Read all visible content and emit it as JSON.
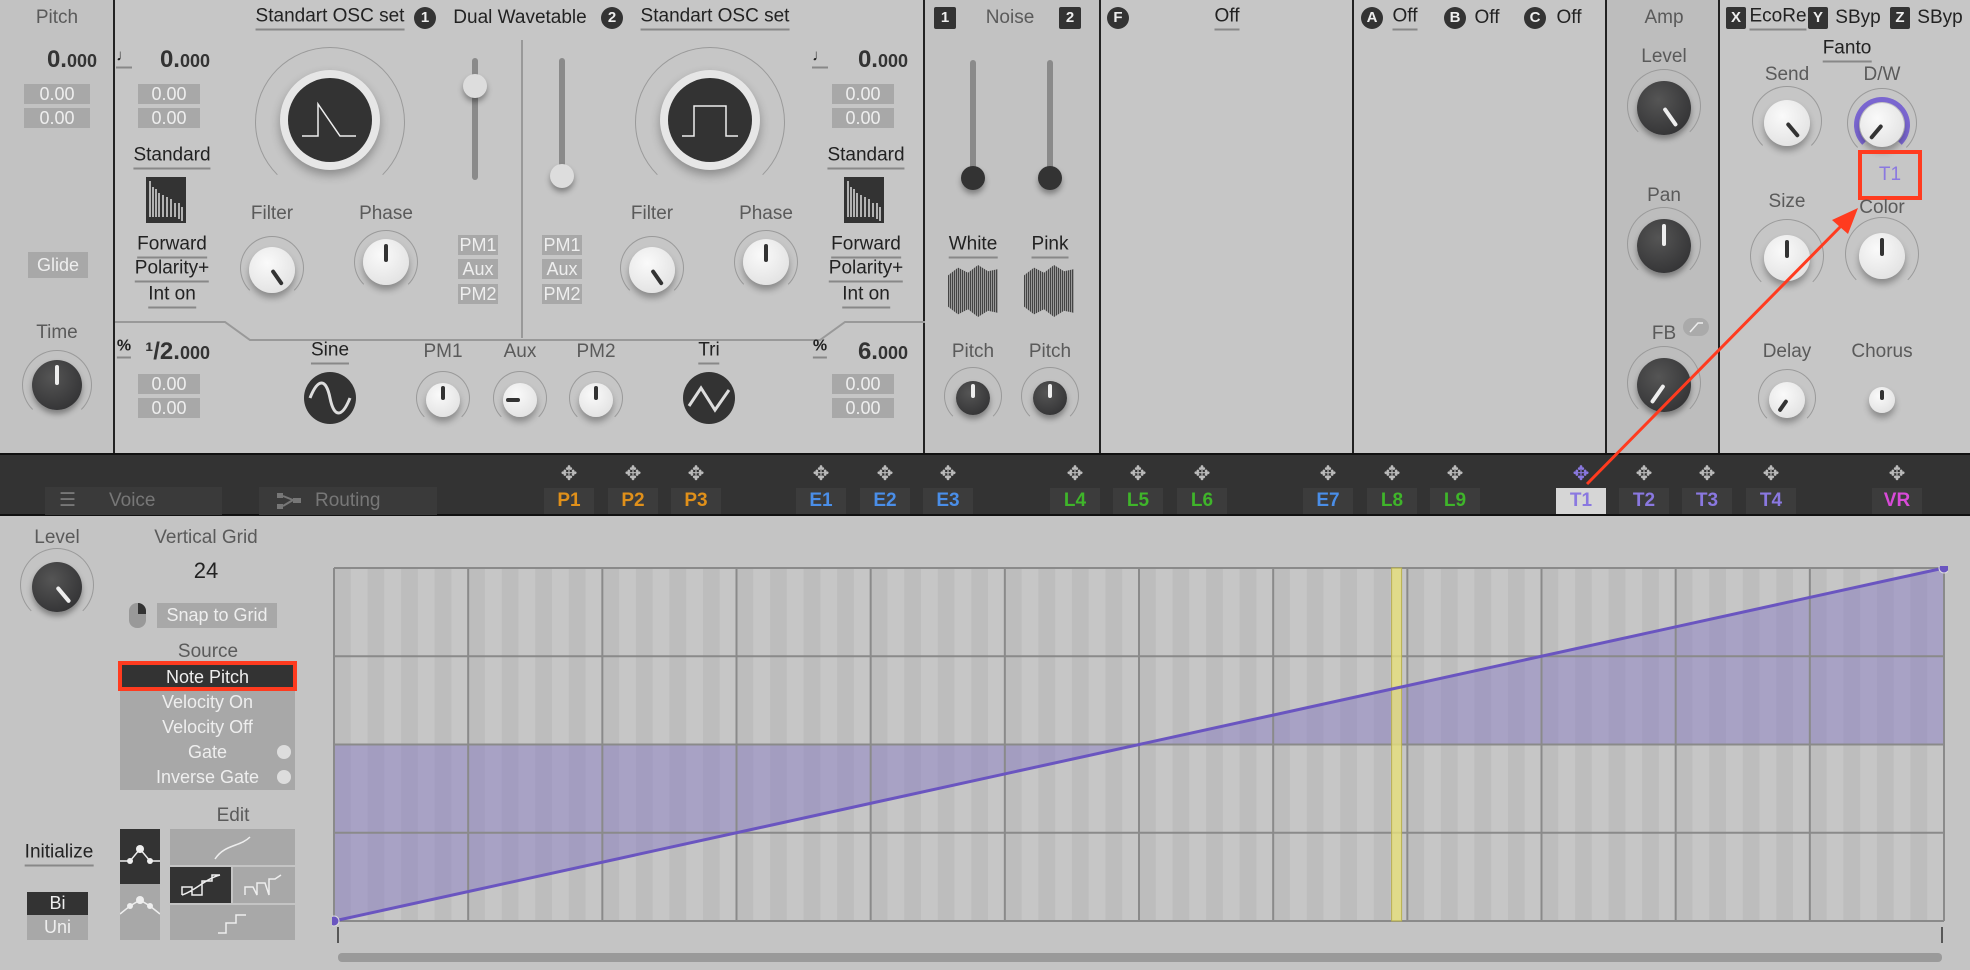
{
  "pitch": {
    "label": "Pitch",
    "value": "0.",
    "value_dec": "000",
    "fine1": "0.00",
    "fine2": "0.00",
    "glide": "Glide",
    "time": "Time"
  },
  "osc": {
    "header": {
      "left_set": "Standart OSC set",
      "badge1": "1",
      "mode": "Dual Wavetable",
      "badge2": "2",
      "right_set": "Standart OSC set"
    },
    "osc1": {
      "pitch": "0.",
      "pitch_dec": "000",
      "fine1": "0.00",
      "fine2": "0.00",
      "table": "Standard",
      "direction": "Forward",
      "polarity": "Polarity+",
      "interp": "Int on",
      "filter": "Filter",
      "phase": "Phase",
      "mods": [
        "PM1",
        "Aux",
        "PM2"
      ],
      "ratio": "¹/2.",
      "ratio_dec": "000",
      "rfine1": "0.00",
      "rfine2": "0.00",
      "wave": "Sine"
    },
    "osc2": {
      "pitch": "0.",
      "pitch_dec": "000",
      "fine1": "0.00",
      "fine2": "0.00",
      "table": "Standard",
      "direction": "Forward",
      "polarity": "Polarity+",
      "interp": "Int on",
      "filter": "Filter",
      "phase": "Phase",
      "mods": [
        "PM1",
        "Aux",
        "PM2"
      ],
      "ratio": "6.",
      "ratio_dec": "000",
      "rfine1": "0.00",
      "rfine2": "0.00",
      "wave": "Tri"
    },
    "pm": {
      "pm1": "PM1",
      "aux": "Aux",
      "pm2": "PM2"
    },
    "percent_symbol": "%",
    "note_symbol": "♩"
  },
  "noise": {
    "badge1": "1",
    "title": "Noise",
    "badge2": "2",
    "white": "White",
    "pink": "Pink",
    "pitch1": "Pitch",
    "pitch2": "Pitch"
  },
  "filter": {
    "badge": "F",
    "value": "Off"
  },
  "fx_slots": [
    {
      "badge": "A",
      "value": "Off"
    },
    {
      "badge": "B",
      "value": "Off"
    },
    {
      "badge": "C",
      "value": "Off"
    }
  ],
  "amp": {
    "title": "Amp",
    "level": "Level",
    "pan": "Pan",
    "fb": "FB"
  },
  "fx": {
    "x": {
      "badge": "X",
      "value": "EcoRe"
    },
    "y": {
      "badge": "Y",
      "value": "SByp"
    },
    "z": {
      "badge": "Z",
      "value": "SByp"
    },
    "preset": "Fanto",
    "send": "Send",
    "dw": "D/W",
    "dw_mod": "T1",
    "size": "Size",
    "color": "Color",
    "delay": "Delay",
    "chorus": "Chorus"
  },
  "bar": {
    "voice": "Voice",
    "routing": "Routing",
    "tabs": [
      {
        "label": "P1",
        "color": "#e0901a"
      },
      {
        "label": "P2",
        "color": "#e0901a"
      },
      {
        "label": "P3",
        "color": "#e0901a"
      },
      {
        "label": "E1",
        "color": "#4a8ee8"
      },
      {
        "label": "E2",
        "color": "#4a8ee8"
      },
      {
        "label": "E3",
        "color": "#4a8ee8"
      },
      {
        "label": "L4",
        "color": "#3fb52a"
      },
      {
        "label": "L5",
        "color": "#3fb52a"
      },
      {
        "label": "L6",
        "color": "#3fb52a"
      },
      {
        "label": "E7",
        "color": "#4a8ee8"
      },
      {
        "label": "L8",
        "color": "#3fb52a"
      },
      {
        "label": "L9",
        "color": "#3fb52a"
      },
      {
        "label": "T1",
        "color": "#8a78e0",
        "active": true
      },
      {
        "label": "T2",
        "color": "#8a78e0"
      },
      {
        "label": "T3",
        "color": "#8a78e0"
      },
      {
        "label": "T4",
        "color": "#8a78e0"
      },
      {
        "label": "VR",
        "color": "#d84ad8"
      }
    ]
  },
  "editor": {
    "level": "Level",
    "vgrid_label": "Vertical Grid",
    "vgrid_value": "24",
    "snap": "Snap to Grid",
    "source_label": "Source",
    "sources": [
      "Note Pitch",
      "Velocity On",
      "Velocity Off",
      "Gate",
      "Inverse Gate"
    ],
    "selected_source": "Note Pitch",
    "edit": "Edit",
    "initialize": "Initialize",
    "bi": "Bi",
    "uni": "Uni",
    "polarity_selected": "Bi"
  },
  "graph": {
    "points": [
      [
        0,
        -1
      ],
      [
        1,
        1
      ]
    ],
    "y_range": [
      -1,
      1
    ],
    "columns": 12,
    "rows": 4,
    "line_color": "#6a55c0",
    "fill_color": "#8a7dc4",
    "marker_position": 0.66
  },
  "colors": {
    "accent": "#7a66d0",
    "highlight": "#ff3b1f"
  }
}
